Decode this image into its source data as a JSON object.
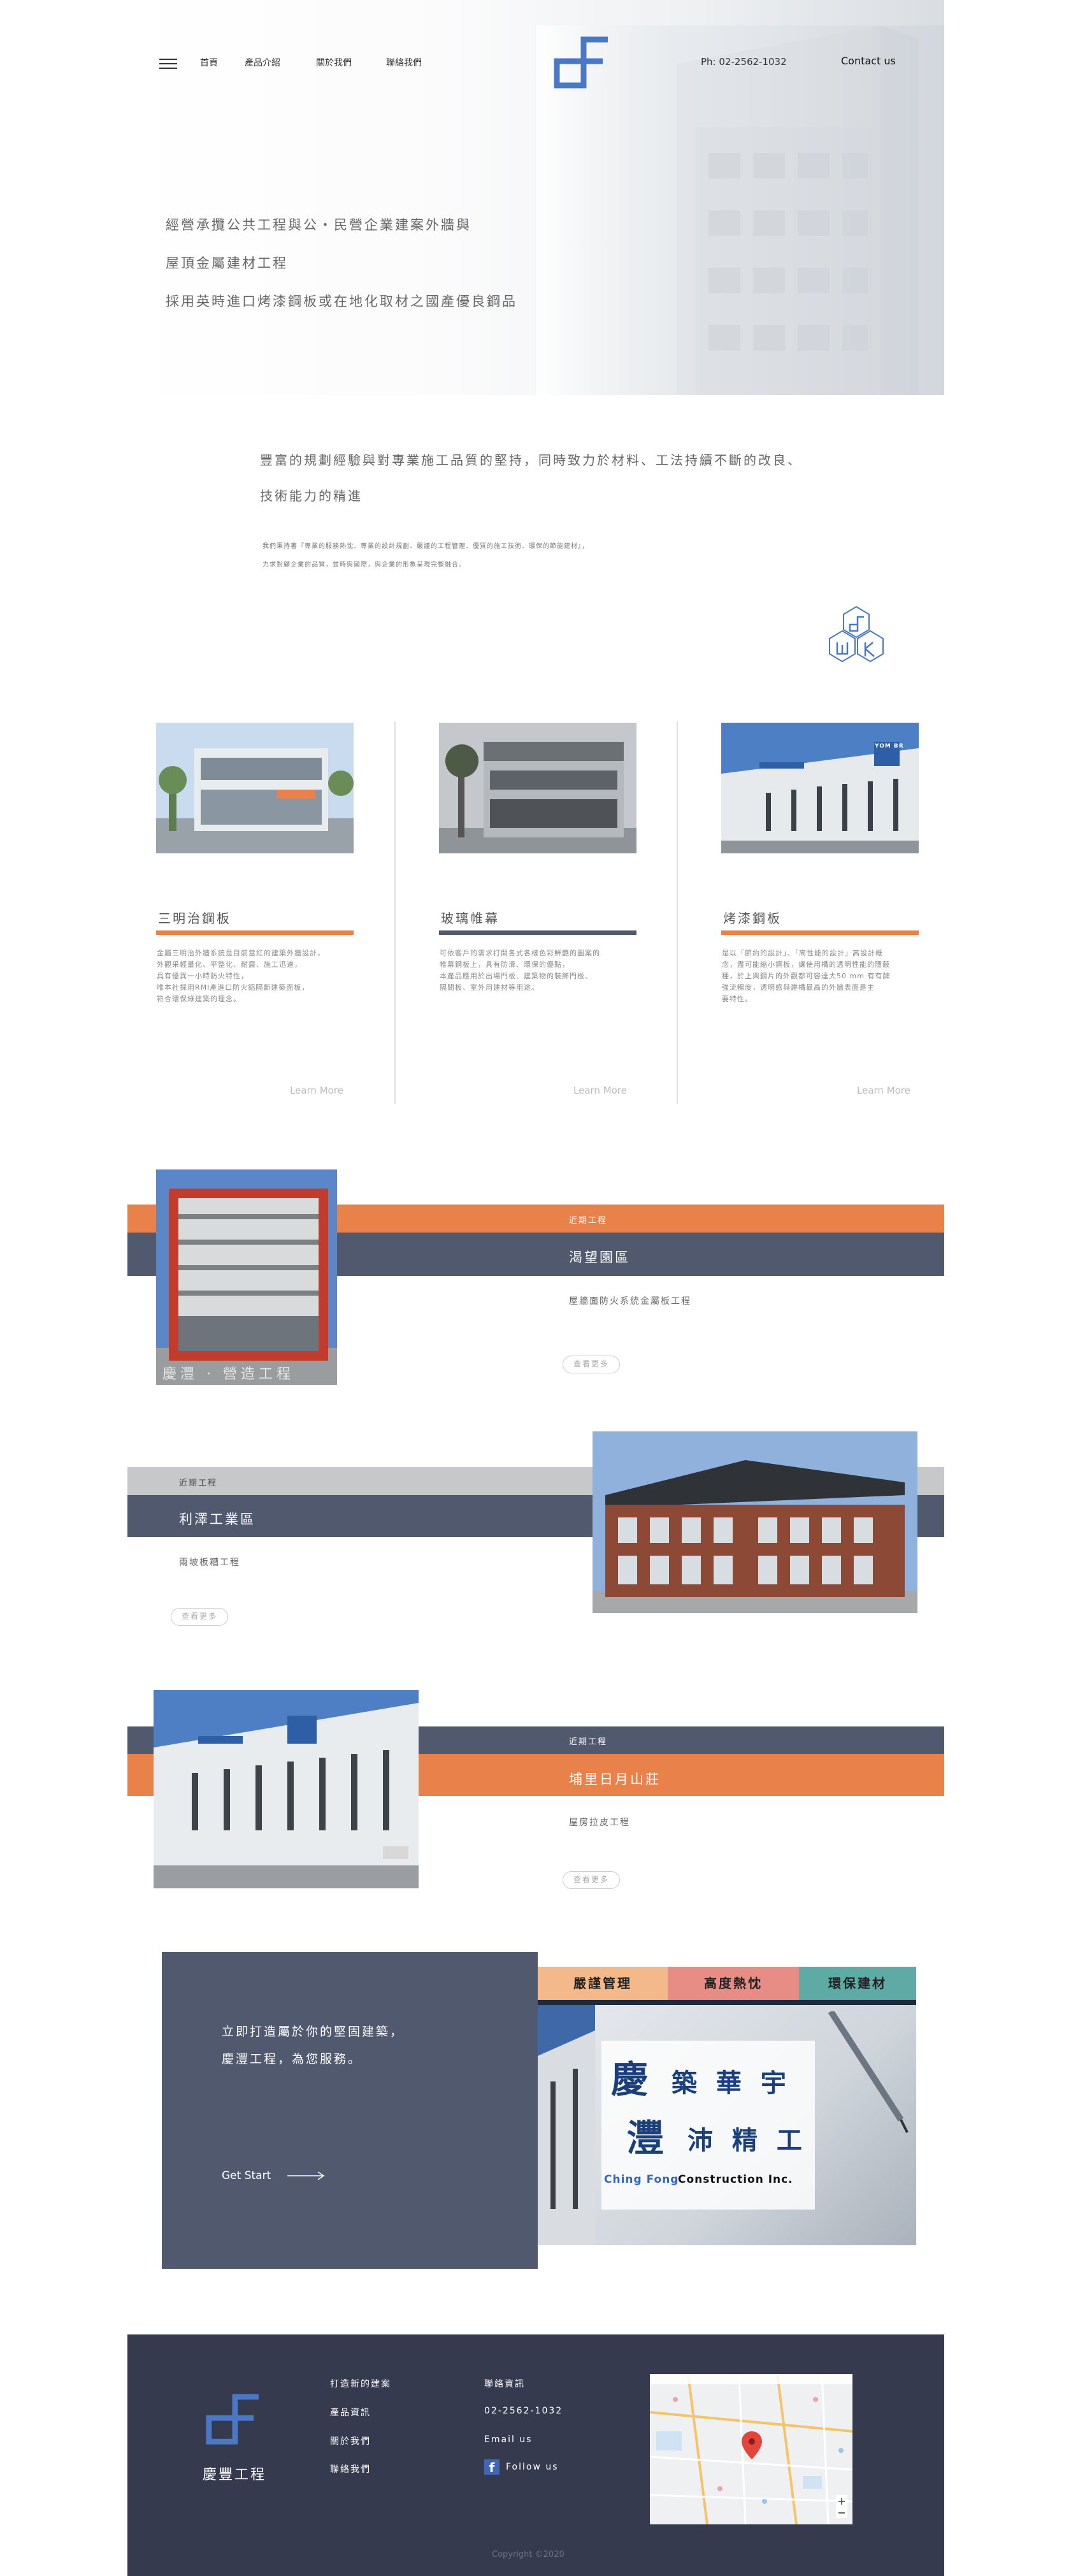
{
  "nav": {
    "items": [
      "首頁",
      "產品介紹",
      "關於我們",
      "聯絡我們"
    ],
    "phone": "Ph:  02-2562-1032",
    "contact": "Contact us"
  },
  "hero": {
    "lines": [
      "經營承攬公共工程與公・民營企業建案外牆與",
      "屋頂金屬建材工程",
      "採用英時進口烤漆鋼板或在地化取材之國產優良鋼品"
    ]
  },
  "intro": {
    "big": [
      "豐富的規劃經驗與對專業施工品質的堅持，同時致力於材料、工法持續不斷的改良、",
      "技術能力的精進"
    ],
    "small": [
      "我們秉持著『專業的服務熱忱、專業的設計規劃、嚴謹的工程管理、優質的施工技術、環保的節能建材』，",
      "力求對顧企業的品質，並時與國際，與企業的形象呈現完整融合。"
    ]
  },
  "products": [
    {
      "title": "三明治鋼板",
      "desc": [
        "金屬三明治外牆系統是目前當紅的建築外牆設計，",
        "外觀采輕量化、平整化、耐震、施工迅速，",
        "具有優異一小時防火特性，",
        "唯本社採用RMI產進口防火鋁隔斷建築面板，",
        "符合環保綠建築的理念。"
      ],
      "learn": "Learn More",
      "bar": "#e8814a"
    },
    {
      "title": "玻璃帷幕",
      "desc": [
        "可依客戶的需求打開各式各樣色彩鮮艷的圖案的",
        "帷幕鋼板上，具有防滑、環保的優點，",
        "本產品應用於出場門板、建築物的裝飾門板、",
        "隔間板、室外用建材等用途。"
      ],
      "learn": "Learn More",
      "bar": "#51596f"
    },
    {
      "title": "烤漆鋼板",
      "desc": [
        "是以「節約的設計」、「高性能的設計」高設計概",
        "念，盡可能縮小鋼板，讓使用構的透明性能的隱蔽",
        "種，於上與鋼片的外觀都可容達大50 mm 有有牌",
        "強流暢度，透明感與建構最高的外牆表面是主",
        "要特性。"
      ],
      "learn": "Learn More",
      "bar": "#e8814a"
    }
  ],
  "projects": [
    {
      "label": "近期工程",
      "name": "渴望園區",
      "sub": "屋牆面防火系統金屬板工程",
      "more": "查看更多"
    },
    {
      "label": "近期工程",
      "name": "利澤工業區",
      "sub": "兩坡板糟工程",
      "more": "查看更多"
    },
    {
      "label": "近期工程",
      "name": "埔里日月山莊",
      "sub": "屋房拉皮工程",
      "more": "查看更多"
    }
  ],
  "photo_caption": "慶灃 · 營造工程",
  "building_sign": "YOM BR",
  "cta": {
    "lines": [
      "立即打造屬於你的堅固建築，",
      "慶灃工程，為您服務。"
    ],
    "start": "Get Start",
    "banner_tags": [
      "嚴謹管理",
      "高度熱忱",
      "環保建材"
    ],
    "banner_big1": "慶",
    "banner_rest1": "築 華 宇",
    "banner_big2": "灃",
    "banner_rest2": "沛 精 工",
    "banner_en1": "Ching Fong",
    "banner_en2": "Construction Inc."
  },
  "footer": {
    "brand": "慶豐工程",
    "links": [
      "打造新的建案",
      "產品資訊",
      "關於我們",
      "聯絡我們"
    ],
    "contact_title": "聯絡資訊",
    "phone": "02-2562-1032",
    "email": "Email us",
    "follow": "Follow us",
    "copyright": "Copyright ©2020"
  },
  "colors": {
    "orange": "#e8814a",
    "slate": "#51596f",
    "navy": "#363a4f",
    "blue": "#4a78c6"
  }
}
